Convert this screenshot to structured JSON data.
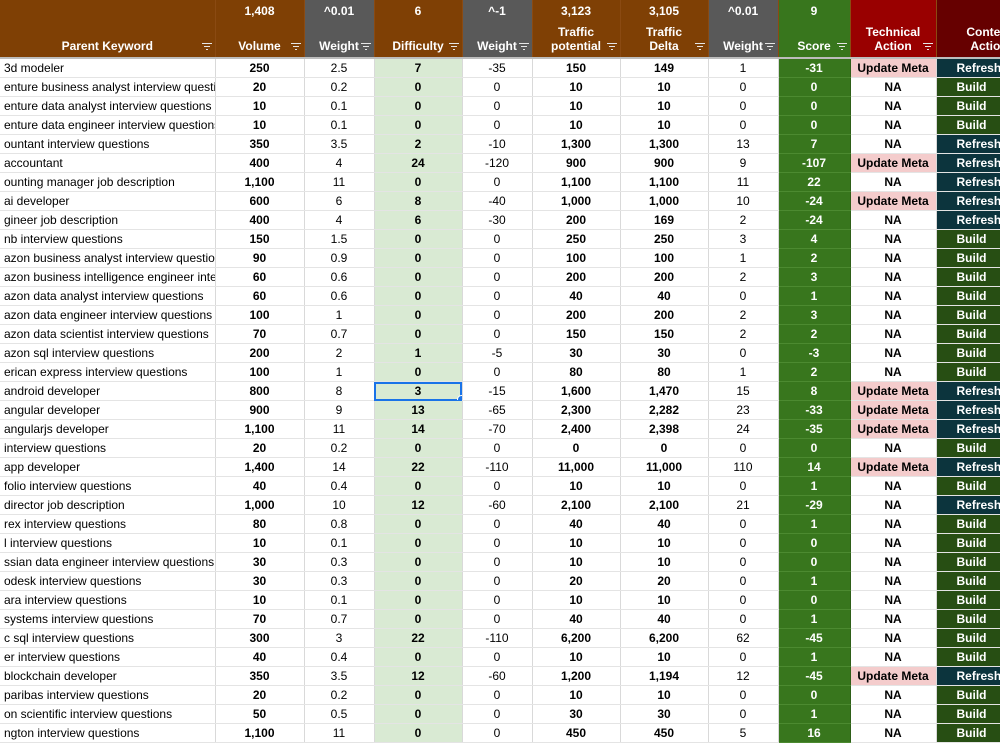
{
  "summary": [
    "",
    "1,408",
    "^0.01",
    "6",
    "^-1",
    "3,123",
    "3,105",
    "^0.01",
    "9",
    "",
    ""
  ],
  "headers": [
    "Parent Keyword",
    "Volume",
    "Weight",
    "Difficulty",
    "Weight",
    "Traffic potential",
    "Traffic Delta",
    "Weight",
    "Score",
    "Technical Action",
    "Content Action"
  ],
  "rows": [
    {
      "keyword": "3d modeler",
      "volume": "250",
      "weight1": "2.5",
      "difficulty": "7",
      "weight2": "-35",
      "tp": "150",
      "delta": "149",
      "weight3": "1",
      "score": "-31",
      "tech": "Update Meta",
      "content": "Refresh"
    },
    {
      "keyword": "enture business analyst interview questior",
      "volume": "20",
      "weight1": "0.2",
      "difficulty": "0",
      "weight2": "0",
      "tp": "10",
      "delta": "10",
      "weight3": "0",
      "score": "0",
      "tech": "NA",
      "content": "Build"
    },
    {
      "keyword": "enture data analyst interview questions",
      "volume": "10",
      "weight1": "0.1",
      "difficulty": "0",
      "weight2": "0",
      "tp": "10",
      "delta": "10",
      "weight3": "0",
      "score": "0",
      "tech": "NA",
      "content": "Build"
    },
    {
      "keyword": "enture data engineer interview questions",
      "volume": "10",
      "weight1": "0.1",
      "difficulty": "0",
      "weight2": "0",
      "tp": "10",
      "delta": "10",
      "weight3": "0",
      "score": "0",
      "tech": "NA",
      "content": "Build"
    },
    {
      "keyword": "ountant interview questions",
      "volume": "350",
      "weight1": "3.5",
      "difficulty": "2",
      "weight2": "-10",
      "tp": "1,300",
      "delta": "1,300",
      "weight3": "13",
      "score": "7",
      "tech": "NA",
      "content": "Refresh"
    },
    {
      "keyword": "accountant",
      "volume": "400",
      "weight1": "4",
      "difficulty": "24",
      "weight2": "-120",
      "tp": "900",
      "delta": "900",
      "weight3": "9",
      "score": "-107",
      "tech": "Update Meta",
      "content": "Refresh"
    },
    {
      "keyword": "ounting manager job description",
      "volume": "1,100",
      "weight1": "11",
      "difficulty": "0",
      "weight2": "0",
      "tp": "1,100",
      "delta": "1,100",
      "weight3": "11",
      "score": "22",
      "tech": "NA",
      "content": "Refresh"
    },
    {
      "keyword": "ai developer",
      "volume": "600",
      "weight1": "6",
      "difficulty": "8",
      "weight2": "-40",
      "tp": "1,000",
      "delta": "1,000",
      "weight3": "10",
      "score": "-24",
      "tech": "Update Meta",
      "content": "Refresh"
    },
    {
      "keyword": "gineer job description",
      "volume": "400",
      "weight1": "4",
      "difficulty": "6",
      "weight2": "-30",
      "tp": "200",
      "delta": "169",
      "weight3": "2",
      "score": "-24",
      "tech": "NA",
      "content": "Refresh"
    },
    {
      "keyword": "nb interview questions",
      "volume": "150",
      "weight1": "1.5",
      "difficulty": "0",
      "weight2": "0",
      "tp": "250",
      "delta": "250",
      "weight3": "3",
      "score": "4",
      "tech": "NA",
      "content": "Build"
    },
    {
      "keyword": "azon business analyst interview questions",
      "volume": "90",
      "weight1": "0.9",
      "difficulty": "0",
      "weight2": "0",
      "tp": "100",
      "delta": "100",
      "weight3": "1",
      "score": "2",
      "tech": "NA",
      "content": "Build"
    },
    {
      "keyword": "azon business intelligence engineer interv",
      "volume": "60",
      "weight1": "0.6",
      "difficulty": "0",
      "weight2": "0",
      "tp": "200",
      "delta": "200",
      "weight3": "2",
      "score": "3",
      "tech": "NA",
      "content": "Build"
    },
    {
      "keyword": "azon data analyst interview questions",
      "volume": "60",
      "weight1": "0.6",
      "difficulty": "0",
      "weight2": "0",
      "tp": "40",
      "delta": "40",
      "weight3": "0",
      "score": "1",
      "tech": "NA",
      "content": "Build"
    },
    {
      "keyword": "azon data engineer interview questions",
      "volume": "100",
      "weight1": "1",
      "difficulty": "0",
      "weight2": "0",
      "tp": "200",
      "delta": "200",
      "weight3": "2",
      "score": "3",
      "tech": "NA",
      "content": "Build"
    },
    {
      "keyword": "azon data scientist interview questions",
      "volume": "70",
      "weight1": "0.7",
      "difficulty": "0",
      "weight2": "0",
      "tp": "150",
      "delta": "150",
      "weight3": "2",
      "score": "2",
      "tech": "NA",
      "content": "Build"
    },
    {
      "keyword": "azon sql interview questions",
      "volume": "200",
      "weight1": "2",
      "difficulty": "1",
      "weight2": "-5",
      "tp": "30",
      "delta": "30",
      "weight3": "0",
      "score": "-3",
      "tech": "NA",
      "content": "Build"
    },
    {
      "keyword": "erican express interview questions",
      "volume": "100",
      "weight1": "1",
      "difficulty": "0",
      "weight2": "0",
      "tp": "80",
      "delta": "80",
      "weight3": "1",
      "score": "2",
      "tech": "NA",
      "content": "Build"
    },
    {
      "keyword": "android developer",
      "volume": "800",
      "weight1": "8",
      "difficulty": "3",
      "weight2": "-15",
      "tp": "1,600",
      "delta": "1,470",
      "weight3": "15",
      "score": "8",
      "tech": "Update Meta",
      "content": "Refresh"
    },
    {
      "keyword": "angular developer",
      "volume": "900",
      "weight1": "9",
      "difficulty": "13",
      "weight2": "-65",
      "tp": "2,300",
      "delta": "2,282",
      "weight3": "23",
      "score": "-33",
      "tech": "Update Meta",
      "content": "Refresh"
    },
    {
      "keyword": "angularjs developer",
      "volume": "1,100",
      "weight1": "11",
      "difficulty": "14",
      "weight2": "-70",
      "tp": "2,400",
      "delta": "2,398",
      "weight3": "24",
      "score": "-35",
      "tech": "Update Meta",
      "content": "Refresh"
    },
    {
      "keyword": "interview questions",
      "volume": "20",
      "weight1": "0.2",
      "difficulty": "0",
      "weight2": "0",
      "tp": "0",
      "delta": "0",
      "weight3": "0",
      "score": "0",
      "tech": "NA",
      "content": "Build"
    },
    {
      "keyword": "app developer",
      "volume": "1,400",
      "weight1": "14",
      "difficulty": "22",
      "weight2": "-110",
      "tp": "11,000",
      "delta": "11,000",
      "weight3": "110",
      "score": "14",
      "tech": "Update Meta",
      "content": "Refresh"
    },
    {
      "keyword": "folio interview questions",
      "volume": "40",
      "weight1": "0.4",
      "difficulty": "0",
      "weight2": "0",
      "tp": "10",
      "delta": "10",
      "weight3": "0",
      "score": "1",
      "tech": "NA",
      "content": "Build"
    },
    {
      "keyword": "director job description",
      "volume": "1,000",
      "weight1": "10",
      "difficulty": "12",
      "weight2": "-60",
      "tp": "2,100",
      "delta": "2,100",
      "weight3": "21",
      "score": "-29",
      "tech": "NA",
      "content": "Refresh"
    },
    {
      "keyword": "rex interview questions",
      "volume": "80",
      "weight1": "0.8",
      "difficulty": "0",
      "weight2": "0",
      "tp": "40",
      "delta": "40",
      "weight3": "0",
      "score": "1",
      "tech": "NA",
      "content": "Build"
    },
    {
      "keyword": "l interview questions",
      "volume": "10",
      "weight1": "0.1",
      "difficulty": "0",
      "weight2": "0",
      "tp": "10",
      "delta": "10",
      "weight3": "0",
      "score": "0",
      "tech": "NA",
      "content": "Build"
    },
    {
      "keyword": "ssian data engineer interview questions",
      "volume": "30",
      "weight1": "0.3",
      "difficulty": "0",
      "weight2": "0",
      "tp": "10",
      "delta": "10",
      "weight3": "0",
      "score": "0",
      "tech": "NA",
      "content": "Build"
    },
    {
      "keyword": "odesk interview questions",
      "volume": "30",
      "weight1": "0.3",
      "difficulty": "0",
      "weight2": "0",
      "tp": "20",
      "delta": "20",
      "weight3": "0",
      "score": "1",
      "tech": "NA",
      "content": "Build"
    },
    {
      "keyword": "ara interview questions",
      "volume": "10",
      "weight1": "0.1",
      "difficulty": "0",
      "weight2": "0",
      "tp": "10",
      "delta": "10",
      "weight3": "0",
      "score": "0",
      "tech": "NA",
      "content": "Build"
    },
    {
      "keyword": "systems interview questions",
      "volume": "70",
      "weight1": "0.7",
      "difficulty": "0",
      "weight2": "0",
      "tp": "40",
      "delta": "40",
      "weight3": "0",
      "score": "1",
      "tech": "NA",
      "content": "Build"
    },
    {
      "keyword": "c sql interview questions",
      "volume": "300",
      "weight1": "3",
      "difficulty": "22",
      "weight2": "-110",
      "tp": "6,200",
      "delta": "6,200",
      "weight3": "62",
      "score": "-45",
      "tech": "NA",
      "content": "Build"
    },
    {
      "keyword": "er interview questions",
      "volume": "40",
      "weight1": "0.4",
      "difficulty": "0",
      "weight2": "0",
      "tp": "10",
      "delta": "10",
      "weight3": "0",
      "score": "1",
      "tech": "NA",
      "content": "Build"
    },
    {
      "keyword": "blockchain developer",
      "volume": "350",
      "weight1": "3.5",
      "difficulty": "12",
      "weight2": "-60",
      "tp": "1,200",
      "delta": "1,194",
      "weight3": "12",
      "score": "-45",
      "tech": "Update Meta",
      "content": "Refresh"
    },
    {
      "keyword": "paribas interview questions",
      "volume": "20",
      "weight1": "0.2",
      "difficulty": "0",
      "weight2": "0",
      "tp": "10",
      "delta": "10",
      "weight3": "0",
      "score": "0",
      "tech": "NA",
      "content": "Build"
    },
    {
      "keyword": "on scientific interview questions",
      "volume": "50",
      "weight1": "0.5",
      "difficulty": "0",
      "weight2": "0",
      "tp": "30",
      "delta": "30",
      "weight3": "0",
      "score": "1",
      "tech": "NA",
      "content": "Build"
    },
    {
      "keyword": "ngton interview questions",
      "volume": "1,100",
      "weight1": "11",
      "difficulty": "0",
      "weight2": "0",
      "tp": "450",
      "delta": "450",
      "weight3": "5",
      "score": "16",
      "tech": "NA",
      "content": "Build"
    }
  ],
  "colors": {
    "header_brown": "#7f4005",
    "header_gray": "#595959",
    "score_green": "#38761d",
    "tech_red": "#990000",
    "content_maroon": "#660000",
    "difficulty_bg": "#d9ead3",
    "update_meta_bg": "#f4cccc",
    "build_bg": "#274e13",
    "refresh_bg": "#0c343d",
    "selection": "#1a73e8"
  },
  "selected_row_index": 17
}
